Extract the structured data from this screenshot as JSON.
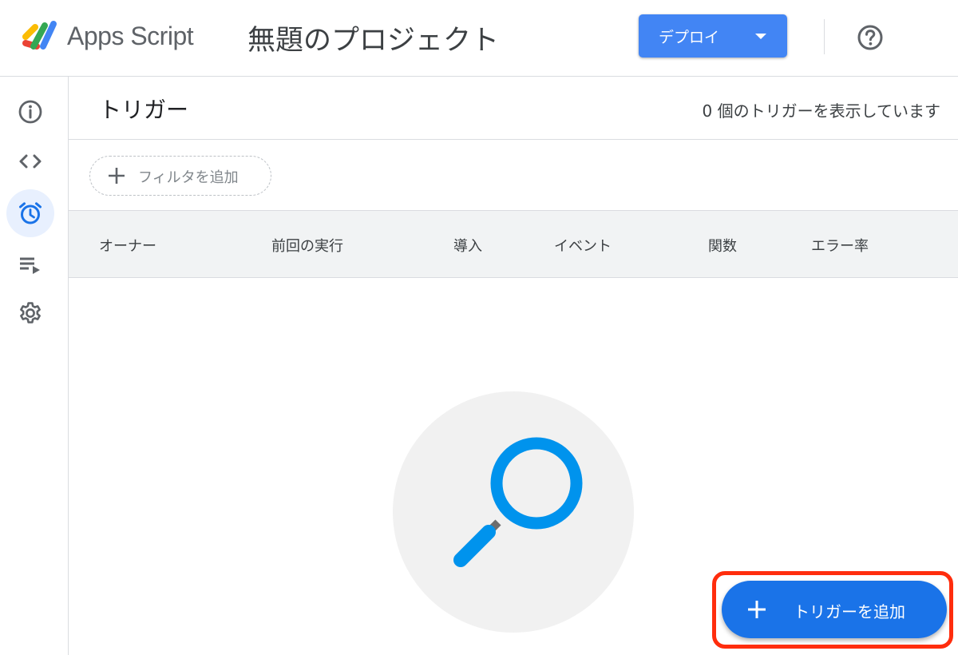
{
  "header": {
    "app_name": "Apps Script",
    "project_title": "無題のプロジェクト",
    "deploy_label": "デプロイ",
    "logo_icon": "apps-script-logo",
    "help_icon": "help-circle-icon"
  },
  "sidebar": {
    "items": [
      {
        "name": "overview",
        "icon": "info-icon",
        "active": false
      },
      {
        "name": "editor",
        "icon": "code-icon",
        "active": false
      },
      {
        "name": "triggers",
        "icon": "alarm-clock-icon",
        "active": true
      },
      {
        "name": "executions",
        "icon": "playlist-play-icon",
        "active": false
      },
      {
        "name": "settings",
        "icon": "gear-icon",
        "active": false
      }
    ]
  },
  "main": {
    "title": "トリガー",
    "count_text": "0 個のトリガーを表示しています",
    "filter": {
      "label": "フィルタを追加",
      "icon": "plus-icon"
    },
    "table": {
      "columns": [
        "オーナー",
        "前回の実行",
        "導入",
        "イベント",
        "関数",
        "エラー率"
      ],
      "rows": []
    },
    "empty_state_icon": "magnifier-icon",
    "add_trigger": {
      "label": "トリガーを追加",
      "icon": "plus-icon"
    }
  },
  "colors": {
    "accent": "#1a73e8",
    "deploy_button": "#4285f4",
    "magnifier": "#0093ed",
    "highlight": "#ff2d0d",
    "active_nav_bg": "#e8f0fe"
  }
}
